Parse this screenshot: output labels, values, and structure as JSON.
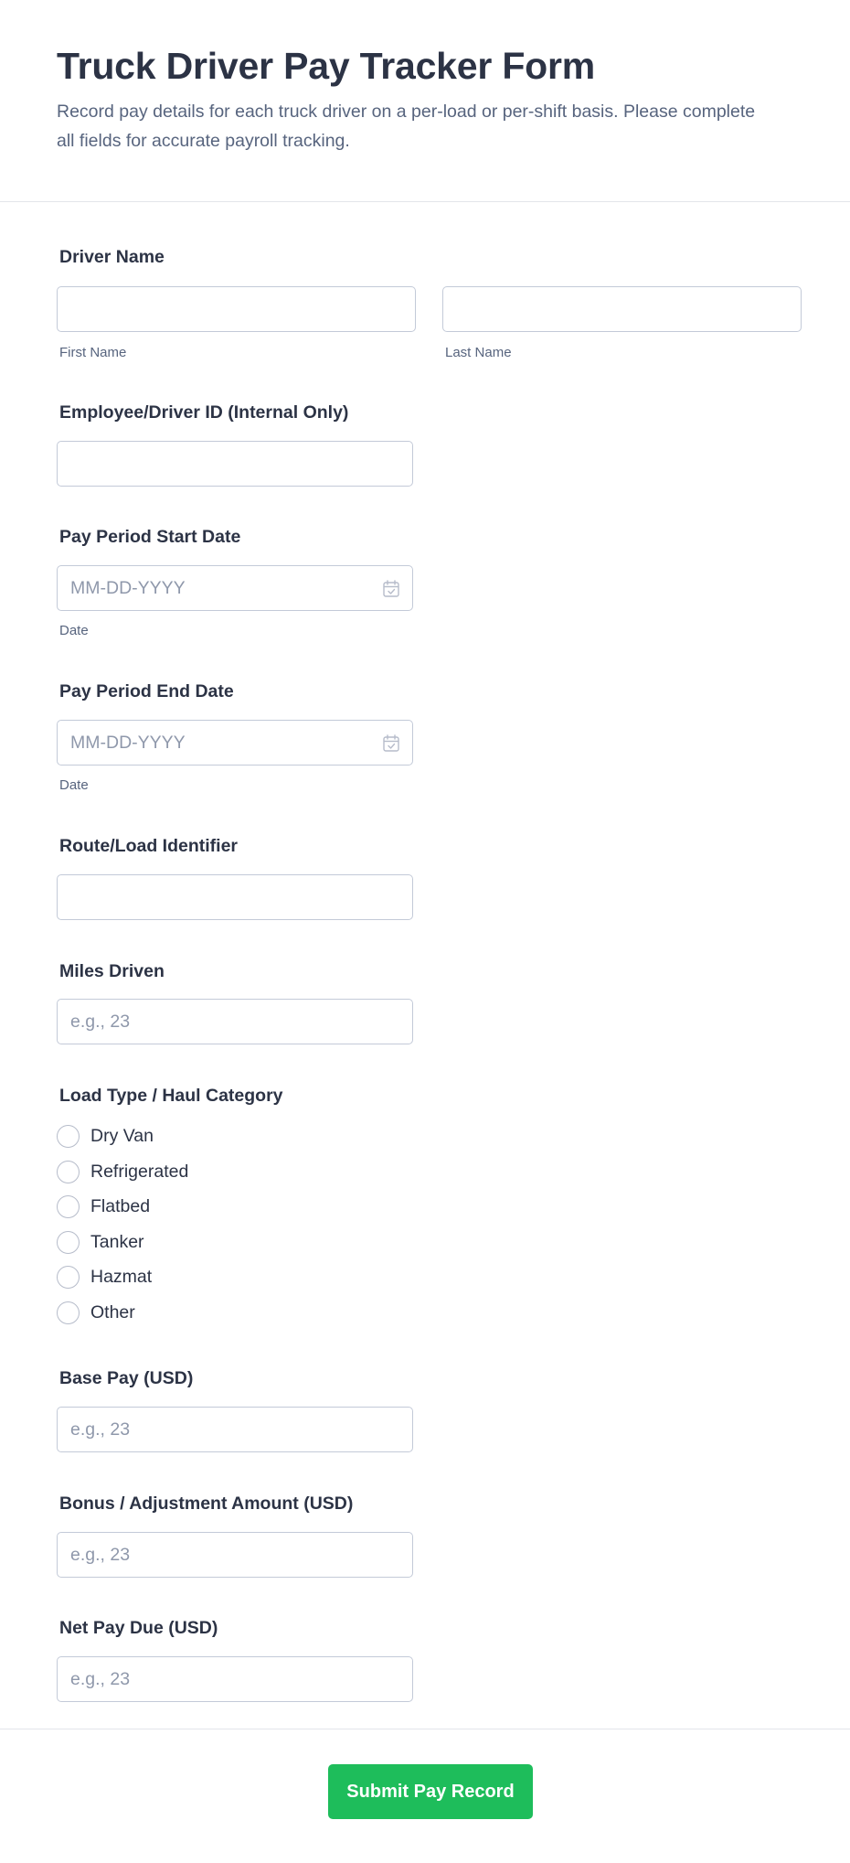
{
  "form": {
    "title": "Truck Driver Pay Tracker Form",
    "description": "Record pay details for each truck driver on a per-load or per-shift basis. Please complete all fields for accurate payroll tracking."
  },
  "fields": {
    "driver_name": {
      "label": "Driver Name",
      "first_name": {
        "value": "",
        "sublabel": "First Name"
      },
      "last_name": {
        "value": "",
        "sublabel": "Last Name"
      }
    },
    "driver_id": {
      "label": "Employee/Driver ID (Internal Only)",
      "value": ""
    },
    "start_date": {
      "label": "Pay Period Start Date",
      "placeholder": "MM-DD-YYYY",
      "sublabel": "Date",
      "icon": "calendar-icon"
    },
    "end_date": {
      "label": "Pay Period End Date",
      "placeholder": "MM-DD-YYYY",
      "sublabel": "Date",
      "icon": "calendar-icon"
    },
    "route": {
      "label": "Route/Load Identifier",
      "value": ""
    },
    "miles": {
      "label": "Miles Driven",
      "placeholder": "e.g., 23"
    },
    "load_type": {
      "label": "Load Type / Haul Category",
      "options": [
        "Dry Van",
        "Refrigerated",
        "Flatbed",
        "Tanker",
        "Hazmat",
        "Other"
      ],
      "selected": null
    },
    "base_pay": {
      "label": "Base Pay (USD)",
      "placeholder": "e.g., 23"
    },
    "bonus": {
      "label": "Bonus / Adjustment Amount (USD)",
      "placeholder": "e.g., 23"
    },
    "net_pay": {
      "label": "Net Pay Due (USD)",
      "placeholder": "e.g., 23"
    }
  },
  "submit": {
    "label": "Submit Pay Record"
  },
  "colors": {
    "title": "#2c3345",
    "subtitle": "#57647e",
    "border": "#c3cad8",
    "placeholder": "#8f98ab",
    "submit_bg": "#1ebd5b",
    "submit_text": "#ffffff"
  }
}
